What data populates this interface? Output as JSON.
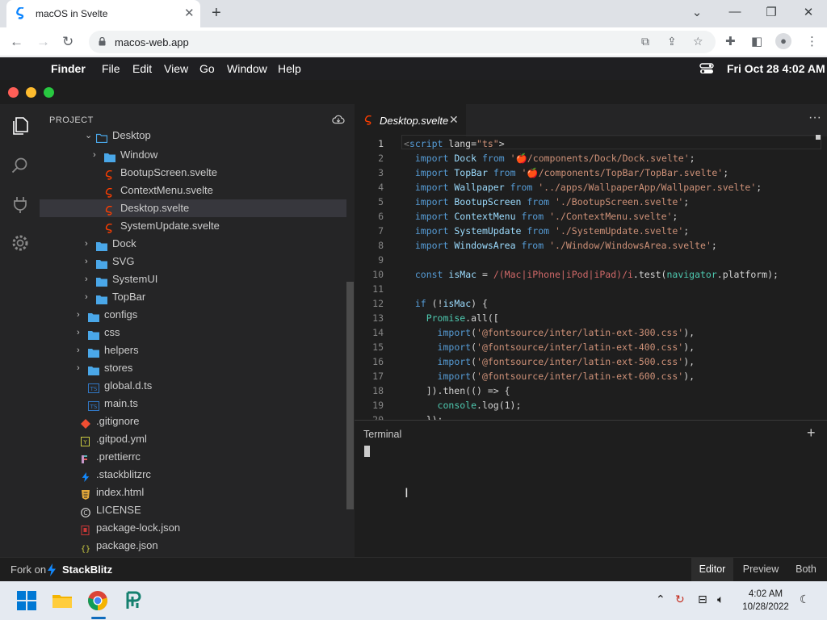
{
  "browser": {
    "tab_title": "macOS in Svelte",
    "url": "macos-web.app",
    "window_controls": {
      "minimize": "⌄",
      "min": "—",
      "restore": "❐",
      "close": "✕"
    }
  },
  "menubar": {
    "items": [
      "Finder",
      "File",
      "Edit",
      "View",
      "Go",
      "Window",
      "Help"
    ],
    "clock": "Fri Oct 28  4:02 AM"
  },
  "explorer": {
    "title": "PROJECT",
    "rows": [
      {
        "label": "Desktop",
        "depth": 3,
        "type": "folder-open",
        "chevron": "⌄"
      },
      {
        "label": "Window",
        "depth": 4,
        "type": "folder",
        "chevron": "›"
      },
      {
        "label": "BootupScreen.svelte",
        "depth": 4,
        "type": "svelte"
      },
      {
        "label": "ContextMenu.svelte",
        "depth": 4,
        "type": "svelte"
      },
      {
        "label": "Desktop.svelte",
        "depth": 4,
        "type": "svelte",
        "selected": true
      },
      {
        "label": "SystemUpdate.svelte",
        "depth": 4,
        "type": "svelte"
      },
      {
        "label": "Dock",
        "depth": 3,
        "type": "folder",
        "chevron": "›"
      },
      {
        "label": "SVG",
        "depth": 3,
        "type": "folder",
        "chevron": "›"
      },
      {
        "label": "SystemUI",
        "depth": 3,
        "type": "folder",
        "chevron": "›"
      },
      {
        "label": "TopBar",
        "depth": 3,
        "type": "folder",
        "chevron": "›"
      },
      {
        "label": "configs",
        "depth": 2,
        "type": "folder",
        "chevron": "›"
      },
      {
        "label": "css",
        "depth": 2,
        "type": "folder",
        "chevron": "›"
      },
      {
        "label": "helpers",
        "depth": 2,
        "type": "folder",
        "chevron": "›"
      },
      {
        "label": "stores",
        "depth": 2,
        "type": "folder",
        "chevron": "›"
      },
      {
        "label": "global.d.ts",
        "depth": 2,
        "type": "ts"
      },
      {
        "label": "main.ts",
        "depth": 2,
        "type": "ts"
      },
      {
        "label": ".gitignore",
        "depth": 1,
        "type": "git"
      },
      {
        "label": ".gitpod.yml",
        "depth": 1,
        "type": "yml"
      },
      {
        "label": ".prettierrc",
        "depth": 1,
        "type": "prettier"
      },
      {
        "label": ".stackblitzrc",
        "depth": 1,
        "type": "bolt"
      },
      {
        "label": "index.html",
        "depth": 1,
        "type": "html"
      },
      {
        "label": "LICENSE",
        "depth": 1,
        "type": "license"
      },
      {
        "label": "package-lock.json",
        "depth": 1,
        "type": "lock"
      },
      {
        "label": "package.json",
        "depth": 1,
        "type": "json"
      }
    ]
  },
  "editor": {
    "tab_label": "Desktop.svelte",
    "more": "···",
    "lines": [
      {
        "n": "1",
        "t": "<script lang=\"ts\">"
      },
      {
        "n": "2",
        "t": "  import Dock from '🍎/components/Dock/Dock.svelte';"
      },
      {
        "n": "3",
        "t": "  import TopBar from '🍎/components/TopBar/TopBar.svelte';"
      },
      {
        "n": "4",
        "t": "  import Wallpaper from '../apps/WallpaperApp/Wallpaper.svelte';"
      },
      {
        "n": "5",
        "t": "  import BootupScreen from './BootupScreen.svelte';"
      },
      {
        "n": "6",
        "t": "  import ContextMenu from './ContextMenu.svelte';"
      },
      {
        "n": "7",
        "t": "  import SystemUpdate from './SystemUpdate.svelte';"
      },
      {
        "n": "8",
        "t": "  import WindowsArea from './Window/WindowsArea.svelte';"
      },
      {
        "n": "9",
        "t": ""
      },
      {
        "n": "10",
        "t": "  const isMac = /(Mac|iPhone|iPod|iPad)/i.test(navigator.platform);"
      },
      {
        "n": "11",
        "t": ""
      },
      {
        "n": "12",
        "t": "  if (!isMac) {"
      },
      {
        "n": "13",
        "t": "    Promise.all(["
      },
      {
        "n": "14",
        "t": "      import('@fontsource/inter/latin-ext-300.css'),"
      },
      {
        "n": "15",
        "t": "      import('@fontsource/inter/latin-ext-400.css'),"
      },
      {
        "n": "16",
        "t": "      import('@fontsource/inter/latin-ext-500.css'),"
      },
      {
        "n": "17",
        "t": "      import('@fontsource/inter/latin-ext-600.css'),"
      },
      {
        "n": "18",
        "t": "    ]).then(() => {"
      },
      {
        "n": "19",
        "t": "      console.log(1);"
      },
      {
        "n": "20",
        "t": "    });"
      }
    ]
  },
  "terminal": {
    "title": "Terminal",
    "add": "+"
  },
  "statusbar": {
    "fork_on": "Fork on",
    "brand": "StackBlitz",
    "views": [
      "Editor",
      "Preview",
      "Both"
    ],
    "active_view": "Editor"
  },
  "taskbar": {
    "time": "4:02 AM",
    "date": "10/28/2022"
  },
  "colors": {
    "accent": "#0f6cbd",
    "svelte": "#ff3e00",
    "folder": "#4aa7e8",
    "keyword": "#569cd6",
    "string": "#ce9178"
  }
}
